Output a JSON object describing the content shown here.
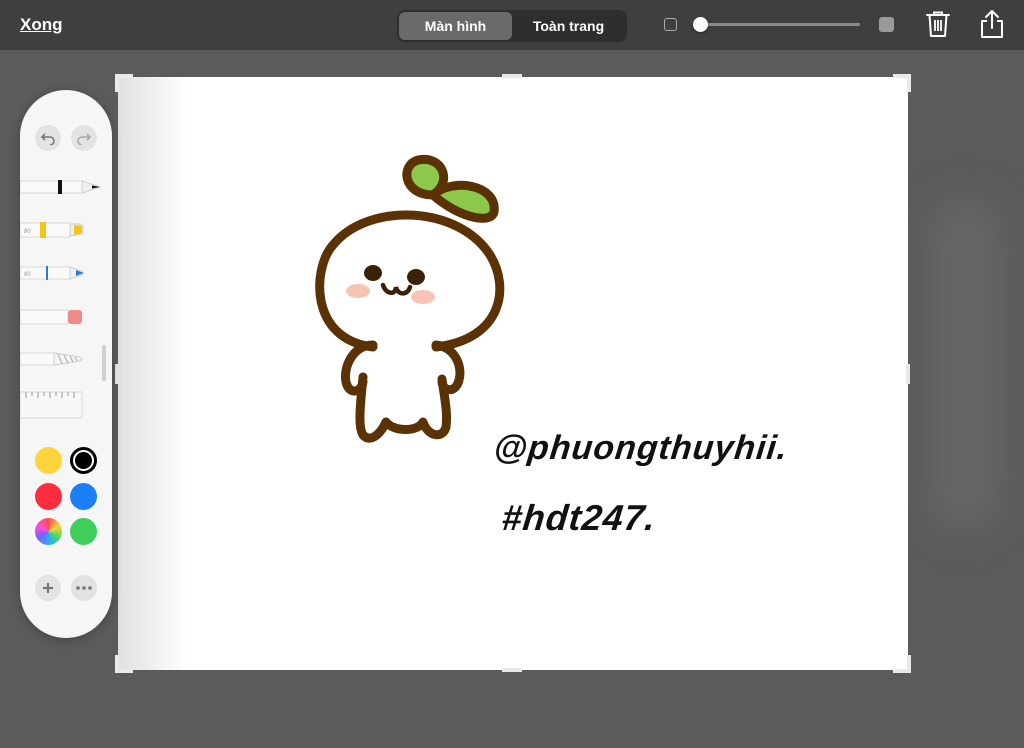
{
  "toolbar": {
    "done_label": "Xong",
    "segments": [
      {
        "label": "Màn hình",
        "active": true
      },
      {
        "label": "Toàn trang",
        "active": false
      }
    ],
    "brush_size_fraction": 0.0,
    "icons": [
      "square-small-icon",
      "square-large-icon",
      "trash-icon",
      "share-icon"
    ]
  },
  "canvas": {
    "watermark_line1": "@phuongthuyhii.",
    "watermark_line2": "#hdt247."
  },
  "palette": {
    "buttons": [
      "undo-icon",
      "redo-icon",
      "add-icon",
      "more-icon"
    ],
    "tools": [
      "pen",
      "highlighter",
      "pencil",
      "eraser",
      "lasso",
      "ruler"
    ],
    "colors": {
      "yellow": "#ffd43b",
      "black": "#000000",
      "red": "#ff2d3f",
      "blue": "#1b7ff5",
      "green": "#3fce5b",
      "selected": "black"
    },
    "accent_colors": {
      "sprout_brown": "#5a3206",
      "leaf_green": "#8cc84b",
      "blush": "#f6b8a6"
    }
  }
}
